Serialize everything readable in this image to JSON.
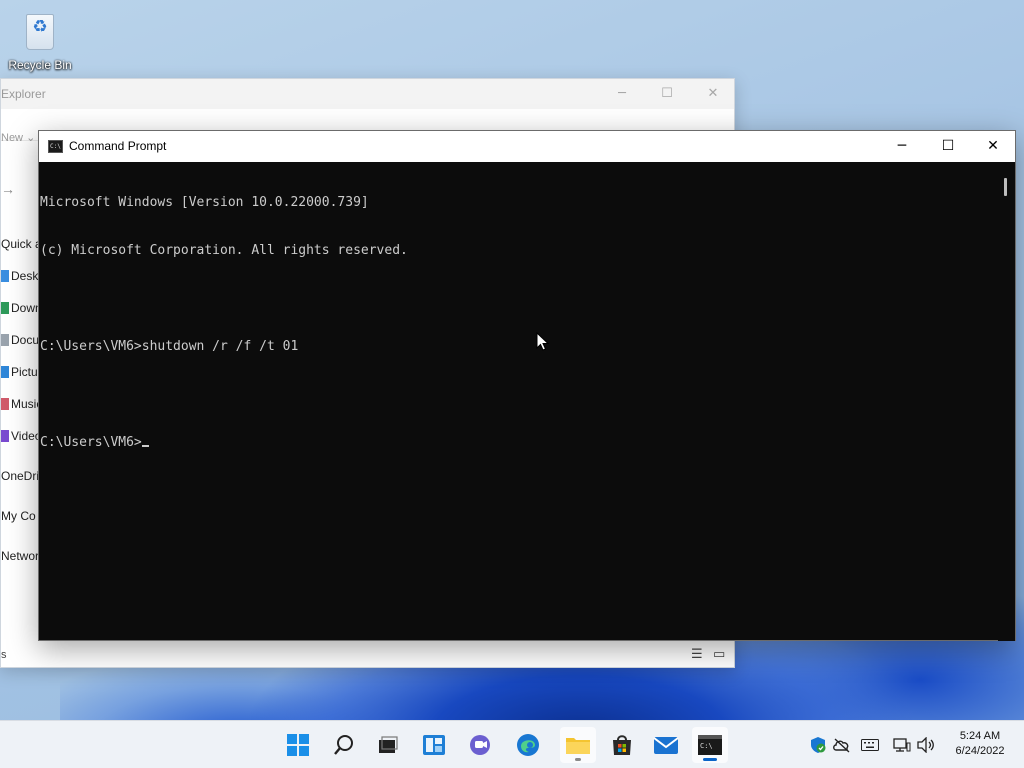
{
  "desktop": {
    "icons": [
      {
        "label": "Recycle Bin",
        "icon": "recycle-bin-icon"
      }
    ]
  },
  "explorer": {
    "title": "Explorer",
    "toolbar_new": "New",
    "sidebar_items": [
      "Quick a",
      "Deskt",
      "Down",
      "Docu",
      "Pictur",
      "Music",
      "Video",
      "OneDri",
      "My Co",
      "Networ"
    ],
    "status_text": "s"
  },
  "cmd": {
    "title": "Command Prompt",
    "minimize": "─",
    "maximize": "☐",
    "close": "✕",
    "lines": [
      "Microsoft Windows [Version 10.0.22000.739]",
      "(c) Microsoft Corporation. All rights reserved.",
      "",
      "C:\\Users\\VM6>shutdown /r /f /t 01",
      "",
      "C:\\Users\\VM6>"
    ]
  },
  "taskbar": {
    "apps": [
      "start-icon",
      "search-icon",
      "task-view-icon",
      "widgets-icon",
      "chat-icon",
      "edge-icon",
      "file-explorer-icon",
      "store-icon",
      "mail-icon",
      "terminal-icon"
    ],
    "clock_time": "5:24 AM",
    "clock_date": "6/24/2022"
  },
  "colors": {
    "console_bg": "#0c0c0c",
    "console_text": "#cccccc",
    "accent": "#0a64c8"
  }
}
